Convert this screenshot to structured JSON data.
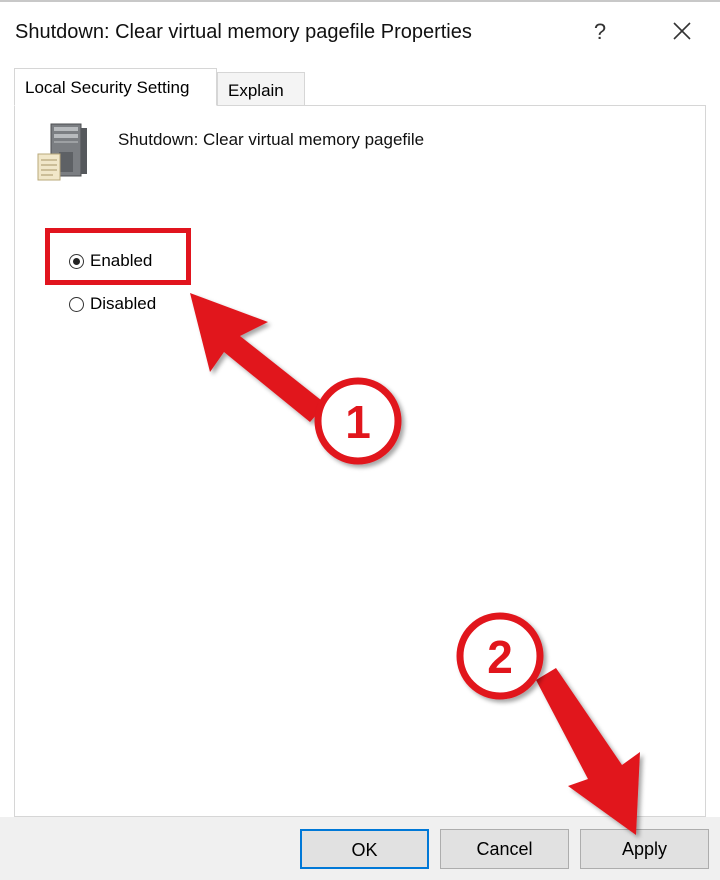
{
  "window": {
    "title": "Shutdown: Clear virtual memory pagefile Properties",
    "help_label": "?"
  },
  "tabs": [
    {
      "label": "Local Security Setting",
      "active": true
    },
    {
      "label": "Explain",
      "active": false
    }
  ],
  "policy": {
    "name": "Shutdown: Clear virtual memory pagefile",
    "icon": "server-icon"
  },
  "options": [
    {
      "label": "Enabled",
      "checked": true
    },
    {
      "label": "Disabled",
      "checked": false
    }
  ],
  "buttons": {
    "ok": "OK",
    "cancel": "Cancel",
    "apply": "Apply"
  },
  "annotations": {
    "step1": "1",
    "step2": "2",
    "color": "#e1141e"
  },
  "colors": {
    "focus_border": "#0078d7",
    "button_face": "#e1e1e1",
    "footer_bg": "#f0f0f0"
  }
}
